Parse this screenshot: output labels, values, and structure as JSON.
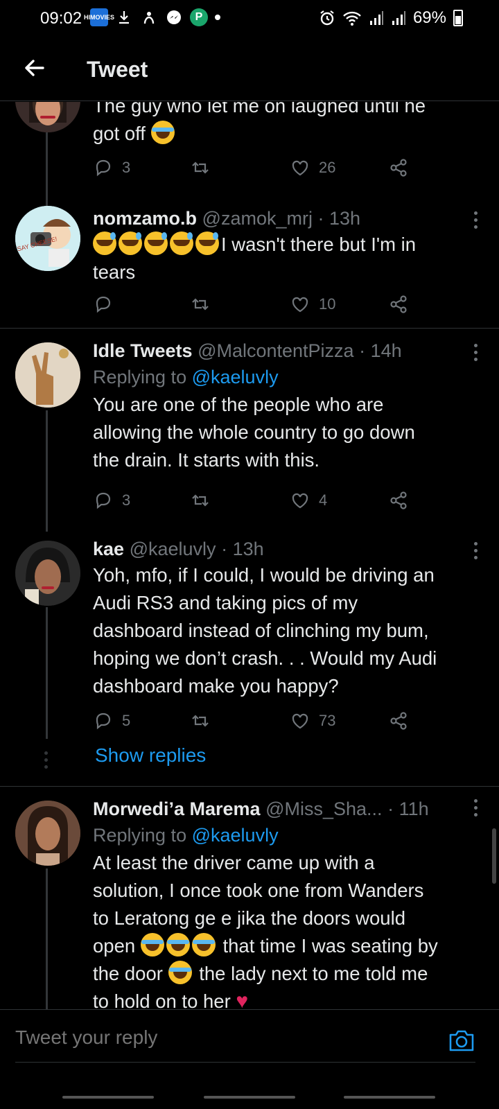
{
  "status_bar": {
    "time": "09:02",
    "battery": "69%",
    "left_icons": [
      "hmovies-icon",
      "download-icon",
      "fingerprint-icon",
      "messenger-icon",
      "p-app-icon",
      "dot-icon"
    ],
    "hmovies_label": "HIMOVIES",
    "p_label": "P",
    "right_icons": [
      "alarm-icon",
      "wifi-icon",
      "signal-icon",
      "signal-icon",
      "battery-icon"
    ]
  },
  "header": {
    "title": "Tweet"
  },
  "tweets": [
    {
      "text_line1": "The guy who let me on laughed until he",
      "text_line2": "got off",
      "replies": "3",
      "likes": "26"
    },
    {
      "name": "nomzamo.b",
      "handle": "@zamok_mrj",
      "sep": "·",
      "time": "13h",
      "text_line1": "I wasn't there but I'm in",
      "text_line2": "tears",
      "avatar_text": "SAY CHEESE!",
      "replies": "",
      "likes": "10"
    },
    {
      "name": "Idle Tweets",
      "handle": "@MalcontentPizza",
      "sep": "·",
      "time": "14h",
      "replying_prefix": "Replying to",
      "replying_handle": "@kaeluvly",
      "text": [
        "You are one of the people who are",
        "allowing the whole country to go down",
        "the drain. It starts with this."
      ],
      "replies": "3",
      "likes": "4"
    },
    {
      "name": "kae",
      "handle": "@kaeluvly",
      "sep": "·",
      "time": "13h",
      "text": [
        "Yoh, mfo, if I could, I would be driving an",
        "Audi RS3 and taking pics of my",
        "dashboard instead of clinching my bum,",
        "hoping we don’t crash. . . Would my Audi",
        "dashboard make you happy?"
      ],
      "replies": "5",
      "likes": "73",
      "show_replies": "Show replies"
    },
    {
      "name": "Morwedi’a Marema",
      "handle": "@Miss_Sha...",
      "sep": "·",
      "time": "11h",
      "replying_prefix": "Replying to",
      "replying_handle": "@kaeluvly",
      "text_line1": "At least the driver came up with a",
      "text_line2": "solution, I once took one from Wanders",
      "text_line3": "to Leratong ge e jika the doors would",
      "text_line4_a": "open",
      "text_line4_b": "that time I was seating by",
      "text_line5_a": "the door",
      "text_line5_b": "the lady next to me told me",
      "text_line6": "to hold on to her"
    }
  ],
  "reply_box": {
    "placeholder": "Tweet your reply"
  },
  "colors": {
    "background": "#000000",
    "link": "#1d9bf0",
    "muted": "#71767b",
    "text": "#e7e9ea",
    "divider": "#2f3336"
  }
}
